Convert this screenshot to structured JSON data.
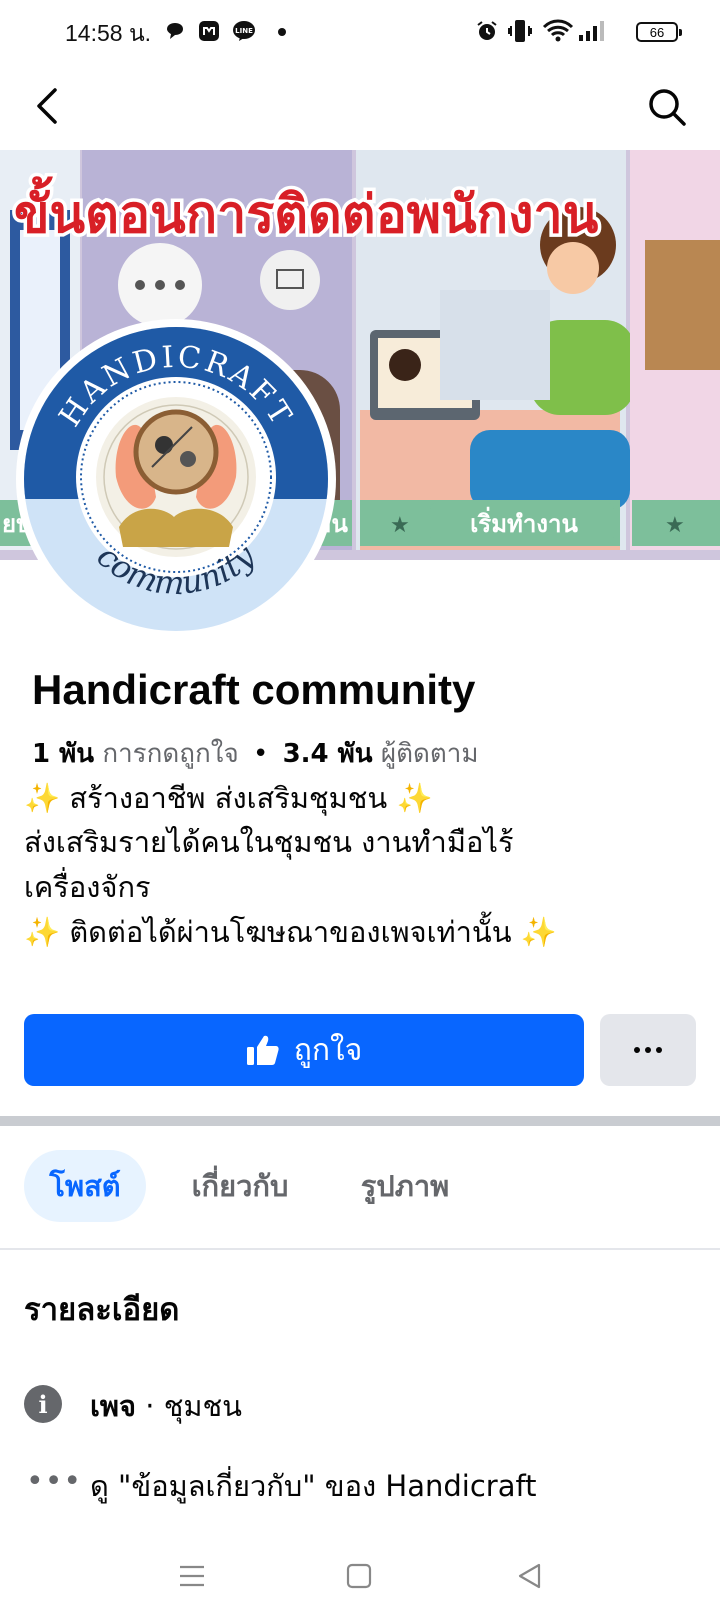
{
  "status_bar": {
    "time": "14:58 น.",
    "battery": "66"
  },
  "cover": {
    "banner_text": "ขั้นตอนการติดต่อพนักงาน",
    "panel_label": "เริ่มทำงาน",
    "panel_label_left": "ยบ",
    "panel_label_mid": "าน"
  },
  "profile": {
    "logo_top_text": "HANDICRAFT",
    "logo_bottom_text": "community"
  },
  "page": {
    "name": "Handicraft community",
    "likes_count": "1 พัน",
    "likes_label": "การกดถูกใจ",
    "separator": "•",
    "followers_count": "3.4 พัน",
    "followers_label": "ผู้ติดตาม",
    "bio": [
      "✨ สร้างอาชีพ ส่งเสริมชุมชน ✨",
      "ส่งเสริมรายได้คนในชุมชน งานทำมือไร้",
      "เครื่องจักร",
      "✨ ติดต่อได้ผ่านโฆษณาของเพจเท่านั้น ✨"
    ]
  },
  "actions": {
    "like_label": "ถูกใจ",
    "more_label": "···"
  },
  "tabs": [
    {
      "label": "โพสต์",
      "active": true
    },
    {
      "label": "เกี่ยวกับ",
      "active": false
    },
    {
      "label": "รูปภาพ",
      "active": false
    }
  ],
  "details": {
    "heading": "รายละเอียด",
    "type_label": "เพจ",
    "type_separator": " · ",
    "category": "ชุมชน",
    "see_about": "ดู \"ข้อมูลเกี่ยวกับ\" ของ Handicraft"
  },
  "colors": {
    "accent": "#0866ff",
    "tab_active_bg": "#e7f3ff",
    "secondary_button": "#e4e6eb",
    "muted_text": "#65676b"
  }
}
